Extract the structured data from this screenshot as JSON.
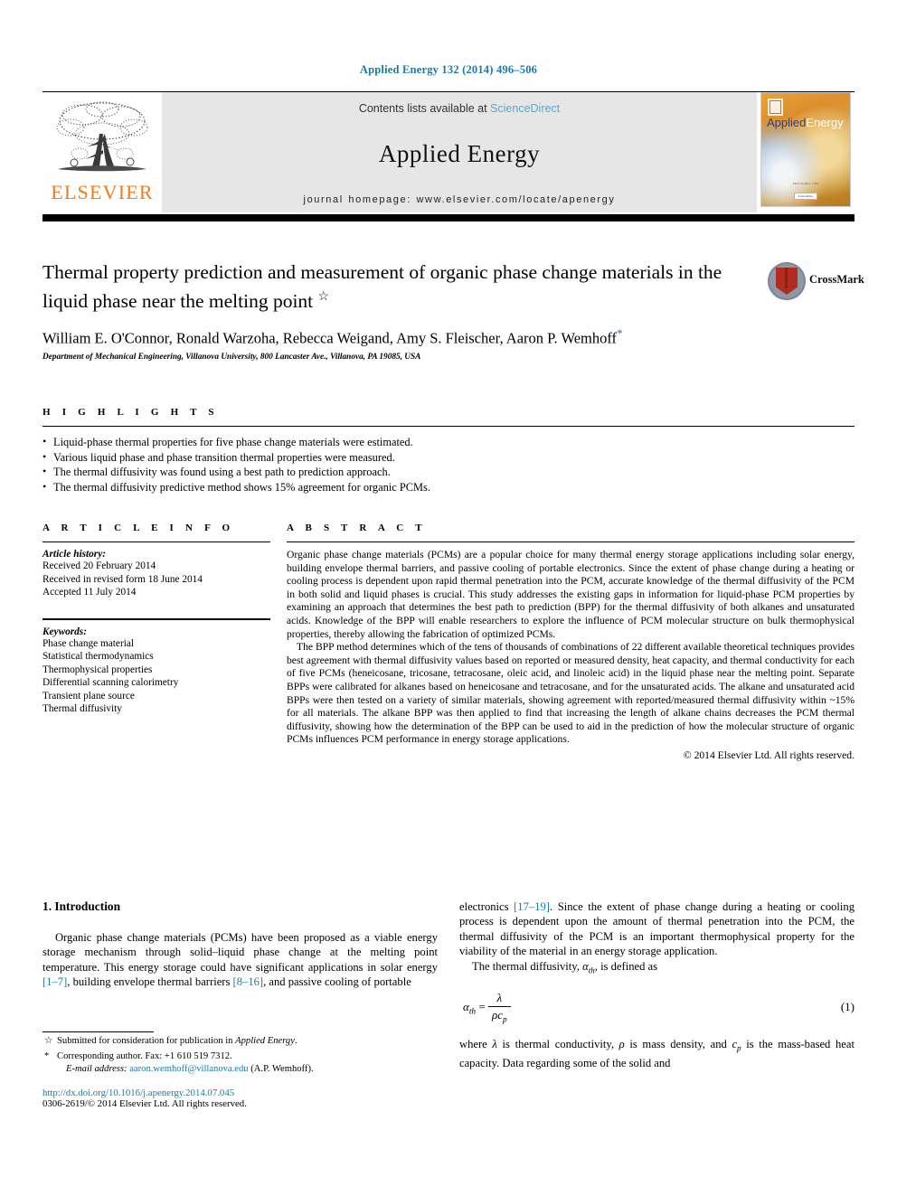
{
  "running_head": "Applied Energy 132 (2014) 496–506",
  "header": {
    "publisher_name": "ELSEVIER",
    "contents_prefix": "Contents lists available at ",
    "contents_link": "ScienceDirect",
    "journal_title": "Applied Energy",
    "homepage": "journal homepage: www.elsevier.com/locate/apenergy",
    "cover": {
      "title_part1": "Applied",
      "title_part2": "Energy",
      "footer_line": "Editor-in-Chief: J. Yan",
      "footer_box": "ScienceDirect"
    }
  },
  "article": {
    "title": "Thermal property prediction and measurement of organic phase change materials in the liquid phase near the melting point",
    "title_mark": "☆",
    "authors": "William E. O'Connor, Ronald Warzoha, Rebecca Weigand, Amy S. Fleischer, Aaron P. Wemhoff",
    "author_mark": "*",
    "affiliation": "Department of Mechanical Engineering, Villanova University, 800 Lancaster Ave., Villanova, PA 19085, USA",
    "crossmark_label": "CrossMark"
  },
  "highlights": {
    "heading": "H I G H L I G H T S",
    "items": [
      "Liquid-phase thermal properties for five phase change materials were estimated.",
      "Various liquid phase and phase transition thermal properties were measured.",
      "The thermal diffusivity was found using a best path to prediction approach.",
      "The thermal diffusivity predictive method shows 15% agreement for organic PCMs."
    ]
  },
  "article_info": {
    "heading": "A R T I C L E    I N F O",
    "history_label": "Article history:",
    "history": [
      "Received 20 February 2014",
      "Received in revised form 18 June 2014",
      "Accepted 11 July 2014"
    ],
    "keywords_label": "Keywords:",
    "keywords": [
      "Phase change material",
      "Statistical thermodynamics",
      "Thermophysical properties",
      "Differential scanning calorimetry",
      "Transient plane source",
      "Thermal diffusivity"
    ]
  },
  "abstract": {
    "heading": "A B S T R A C T",
    "paragraph1": "Organic phase change materials (PCMs) are a popular choice for many thermal energy storage applications including solar energy, building envelope thermal barriers, and passive cooling of portable electronics. Since the extent of phase change during a heating or cooling process is dependent upon rapid thermal penetration into the PCM, accurate knowledge of the thermal diffusivity of the PCM in both solid and liquid phases is crucial. This study addresses the existing gaps in information for liquid-phase PCM properties by examining an approach that determines the best path to prediction (BPP) for the thermal diffusivity of both alkanes and unsaturated acids. Knowledge of the BPP will enable researchers to explore the influence of PCM molecular structure on bulk thermophysical properties, thereby allowing the fabrication of optimized PCMs.",
    "paragraph2": "The BPP method determines which of the tens of thousands of combinations of 22 different available theoretical techniques provides best agreement with thermal diffusivity values based on reported or measured density, heat capacity, and thermal conductivity for each of five PCMs (heneicosane, tricosane, tetracosane, oleic acid, and linoleic acid) in the liquid phase near the melting point. Separate BPPs were calibrated for alkanes based on heneicosane and tetracosane, and for the unsaturated acids. The alkane and unsaturated acid BPPs were then tested on a variety of similar materials, showing agreement with reported/measured thermal diffusivity within ~15% for all materials. The alkane BPP was then applied to find that increasing the length of alkane chains decreases the PCM thermal diffusivity, showing how the determination of the BPP can be used to aid in the prediction of how the molecular structure of organic PCMs influences PCM performance in energy storage applications.",
    "copyright": "© 2014 Elsevier Ltd. All rights reserved."
  },
  "introduction": {
    "heading": "1. Introduction",
    "col1_p1_a": "Organic phase change materials (PCMs) have been proposed as a viable energy storage mechanism through solid–liquid phase change at the melting point temperature. This energy storage could have significant applications in solar energy ",
    "col1_ref1": "[1–7]",
    "col1_p1_b": ", building envelope thermal barriers ",
    "col1_ref2": "[8–16]",
    "col1_p1_c": ", and passive cooling of portable",
    "col2_p1_a": "electronics ",
    "col2_ref1": "[17–19]",
    "col2_p1_b": ". Since the extent of phase change during a heating or cooling process is dependent upon the amount of thermal penetration into the PCM, the thermal diffusivity of the PCM is an important thermophysical property for the viability of the material in an energy storage application.",
    "col2_p2_a": "The thermal diffusivity, ",
    "col2_p2_sym": "α",
    "col2_p2_sub": "th",
    "col2_p2_b": ", is defined as",
    "equation": {
      "lhs_sym": "α",
      "lhs_sub": "th",
      "eq": "=",
      "numerator": "λ",
      "denominator_rho": "ρ",
      "denominator_c": "c",
      "denominator_sub": "p",
      "number": "(1)"
    },
    "col2_p3": "where λ is thermal conductivity, ρ is mass density, and cp is the mass-based heat capacity. Data regarding some of the solid and",
    "col2_p3_parts": {
      "a": "where ",
      "lambda": "λ",
      "b": " is thermal conductivity, ",
      "rho": "ρ",
      "c": " is mass density, and ",
      "cp": "c",
      "cp_sub": "p",
      "d": " is the mass-based heat capacity. Data regarding some of the solid and"
    }
  },
  "footnotes": {
    "note1_mark": "☆",
    "note1_a": "Submitted for consideration for publication in ",
    "note1_italic": "Applied Energy",
    "note1_b": ".",
    "note2_mark": "*",
    "note2": "Corresponding author. Fax: +1 610 519 7312.",
    "email_label": "E-mail address:",
    "email": "aaron.wemhoff@villanova.edu",
    "email_suffix": "(A.P. Wemhoff).",
    "doi": "http://dx.doi.org/10.1016/j.apenergy.2014.07.045",
    "issn": "0306-2619/© 2014 Elsevier Ltd. All rights reserved."
  },
  "colors": {
    "link": "#1a7aa8",
    "sciencedirect": "#5aa9d6",
    "elsevier_orange": "#ef7d1a",
    "header_grey": "#e6e6e6"
  }
}
